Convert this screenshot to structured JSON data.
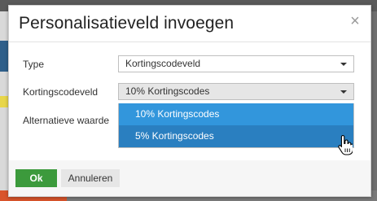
{
  "dialog": {
    "title": "Personalisatieveld invoegen",
    "close_glyph": "×"
  },
  "form": {
    "type_label": "Type",
    "type_value": "Kortingscodeveld",
    "field_label": "Kortingscodeveld",
    "field_value": "10% Kortingscodes",
    "alt_label": "Alternatieve waarde"
  },
  "dropdown": {
    "options": [
      "10% Kortingscodes",
      "5% Kortingscodes"
    ]
  },
  "footer": {
    "ok_label": "Ok",
    "cancel_label": "Annuleren"
  },
  "colors": {
    "ok_green": "#3c9a3c",
    "option_blue": "#3296dc",
    "option_hover_blue": "#2a7fc0"
  },
  "icons": {
    "close": "close-icon",
    "caret": "chevron-down-icon",
    "cursor": "hand-pointer-icon"
  }
}
